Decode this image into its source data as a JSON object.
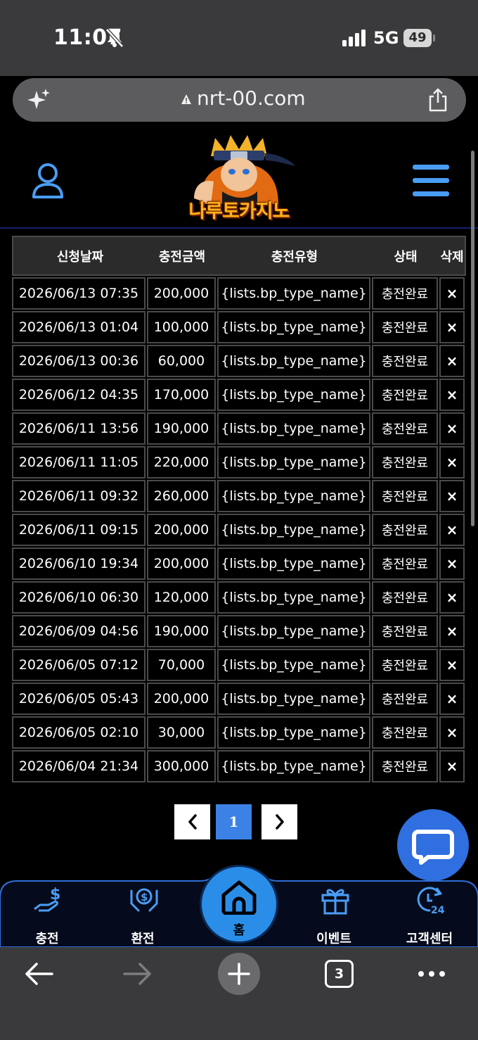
{
  "status_bar": {
    "time": "11:07",
    "network": "5G",
    "battery": "49"
  },
  "browser": {
    "url": "nrt-00.com",
    "tab_count": "3"
  },
  "site": {
    "logo_text": "나루토카지노"
  },
  "table": {
    "headers": [
      "신청날짜",
      "충전금액",
      "충전유형",
      "상태",
      "삭제"
    ],
    "rows": [
      [
        "2026/06/13 07:35",
        "200,000",
        "{lists.bp_type_name}",
        "충전완료",
        "×"
      ],
      [
        "2026/06/13 01:04",
        "100,000",
        "{lists.bp_type_name}",
        "충전완료",
        "×"
      ],
      [
        "2026/06/13 00:36",
        "60,000",
        "{lists.bp_type_name}",
        "충전완료",
        "×"
      ],
      [
        "2026/06/12 04:35",
        "170,000",
        "{lists.bp_type_name}",
        "충전완료",
        "×"
      ],
      [
        "2026/06/11 13:56",
        "190,000",
        "{lists.bp_type_name}",
        "충전완료",
        "×"
      ],
      [
        "2026/06/11 11:05",
        "220,000",
        "{lists.bp_type_name}",
        "충전완료",
        "×"
      ],
      [
        "2026/06/11 09:32",
        "260,000",
        "{lists.bp_type_name}",
        "충전완료",
        "×"
      ],
      [
        "2026/06/11 09:15",
        "200,000",
        "{lists.bp_type_name}",
        "충전완료",
        "×"
      ],
      [
        "2026/06/10 19:34",
        "200,000",
        "{lists.bp_type_name}",
        "충전완료",
        "×"
      ],
      [
        "2026/06/10 06:30",
        "120,000",
        "{lists.bp_type_name}",
        "충전완료",
        "×"
      ],
      [
        "2026/06/09 04:56",
        "190,000",
        "{lists.bp_type_name}",
        "충전완료",
        "×"
      ],
      [
        "2026/06/05 07:12",
        "70,000",
        "{lists.bp_type_name}",
        "충전완료",
        "×"
      ],
      [
        "2026/06/05 05:43",
        "200,000",
        "{lists.bp_type_name}",
        "충전완료",
        "×"
      ],
      [
        "2026/06/05 02:10",
        "30,000",
        "{lists.bp_type_name}",
        "충전완료",
        "×"
      ],
      [
        "2026/06/04 21:34",
        "300,000",
        "{lists.bp_type_name}",
        "충전완료",
        "×"
      ]
    ]
  },
  "pagination": {
    "prev": "‹",
    "current_page": "1",
    "next": "›"
  },
  "bottom_nav": {
    "charge": "충전",
    "exchange": "환전",
    "home": "홈",
    "event": "이벤트",
    "support": "고객센터"
  },
  "colors": {
    "accent": "#3c82e6",
    "icon_blue": "#4a9df5",
    "table_border": "#4a4a4a"
  }
}
